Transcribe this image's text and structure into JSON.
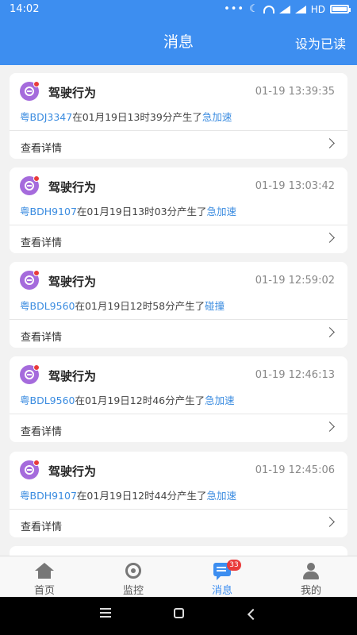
{
  "status": {
    "time": "14:02",
    "network": "HD"
  },
  "header": {
    "title": "消息",
    "mark_read": "设为已读"
  },
  "messages": [
    {
      "title": "驾驶行为",
      "time": "01-19 13:39:35",
      "plate": "粤BDJ3347",
      "middle": "在01月19日13时39分产生了",
      "event": "急加速",
      "detail": "查看详情"
    },
    {
      "title": "驾驶行为",
      "time": "01-19 13:03:42",
      "plate": "粤BDH9107",
      "middle": "在01月19日13时03分产生了",
      "event": "急加速",
      "detail": "查看详情"
    },
    {
      "title": "驾驶行为",
      "time": "01-19 12:59:02",
      "plate": "粤BDL9560",
      "middle": "在01月19日12时58分产生了",
      "event": "碰撞",
      "detail": "查看详情"
    },
    {
      "title": "驾驶行为",
      "time": "01-19 12:46:13",
      "plate": "粤BDL9560",
      "middle": "在01月19日12时46分产生了",
      "event": "急加速",
      "detail": "查看详情"
    },
    {
      "title": "驾驶行为",
      "time": "01-19 12:45:06",
      "plate": "粤BDH9107",
      "middle": "在01月19日12时44分产生了",
      "event": "急加速",
      "detail": "查看详情"
    }
  ],
  "tabs": [
    {
      "label": "首页",
      "icon": "home-icon"
    },
    {
      "label": "监控",
      "icon": "monitor-icon"
    },
    {
      "label": "消息",
      "icon": "message-icon",
      "badge": "33",
      "active": true
    },
    {
      "label": "我的",
      "icon": "person-icon"
    }
  ],
  "colors": {
    "primary": "#3d8ef0",
    "badge": "#e93b3b",
    "icon_bg": "#a56bdc"
  }
}
